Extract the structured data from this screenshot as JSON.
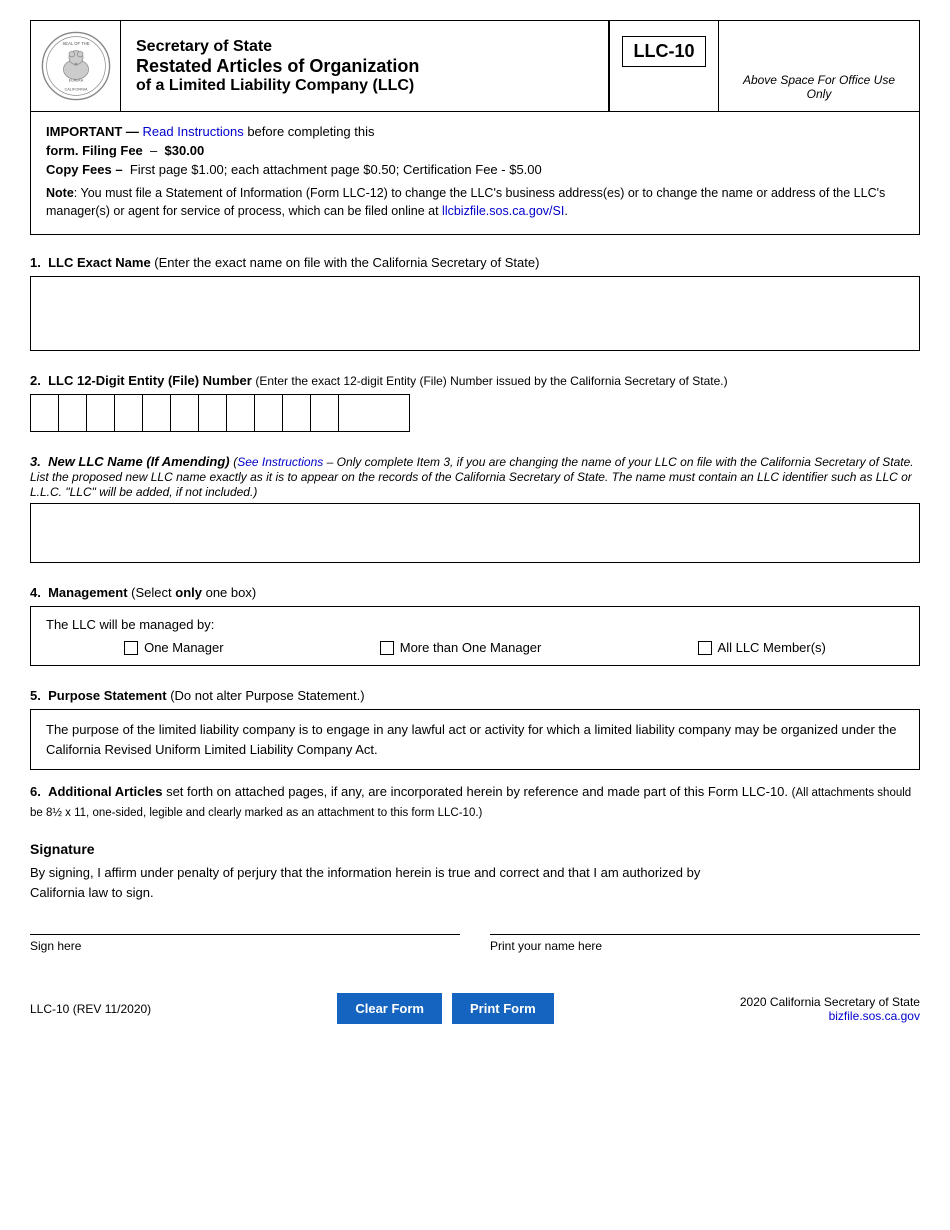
{
  "header": {
    "agency": "Secretary of State",
    "form_title": "Restated Articles of Organization",
    "form_subtitle": "of a Limited Liability Company",
    "form_subtitle_abbr": "(LLC)",
    "form_id": "LLC-10",
    "office_use": "Above Space For Office Use Only"
  },
  "info": {
    "important_prefix": "IMPORTANT — ",
    "important_link_text": "Read Instructions",
    "important_suffix": " before completing this",
    "form_fee_label": "form. Filing Fee",
    "form_fee_dash": "–",
    "form_fee_amount": "$30.00",
    "copy_fees_label": "Copy Fees –",
    "copy_fees_detail": "First page $1.00; each attachment page $0.50; Certification Fee - $5.00",
    "note_label": "Note",
    "note_text": ": You must file a Statement of Information (Form LLC-12) to change the LLC's business address(es) or to change the name or address of the LLC's manager(s) or agent for service of process, which can be filed online at ",
    "note_link": "llcbizfile.sos.ca.gov/SI",
    "note_end": "."
  },
  "section1": {
    "number": "1.",
    "label": "LLC Exact Name",
    "description": "(Enter the exact name on file with the California Secretary of State)"
  },
  "section2": {
    "number": "2.",
    "label": "LLC 12-Digit Entity (File) Number",
    "description": "(Enter the exact 12-digit Entity (File) Number issued by the California Secretary of State.)",
    "cells": 12
  },
  "section3": {
    "number": "3.",
    "label": "New LLC Name (If Amending)",
    "instructions_link": "See Instructions",
    "description": "– Only complete Item 3, if you are changing the name of your LLC on file with the California Secretary of State.  List the proposed new LLC name exactly as it is to appear on the records of the California Secretary of State. The name must contain an LLC identifier such as LLC or L.L.C. \"LLC\" will be added, if not included."
  },
  "section4": {
    "number": "4.",
    "label": "Management",
    "description": "(Select ",
    "bold_word": "only",
    "description2": " one box)",
    "managed_by": "The LLC will be managed by:",
    "option1": "One Manager",
    "option2": "More than One Manager",
    "option3": "All LLC Member(s)"
  },
  "section5": {
    "number": "5.",
    "label": "Purpose Statement",
    "description": "(Do not alter Purpose Statement.)",
    "text": "The purpose of the limited liability company is to engage in any lawful act or activity for which a limited liability company may be organized under the California Revised Uniform Limited Liability Company Act."
  },
  "section6": {
    "number": "6.",
    "label": "Additional Articles",
    "text": "set forth on attached pages, if any, are incorporated herein by reference and made part of this Form LLC-10.",
    "note": "(All attachments should be 8½ x 11, one-sided, legible and clearly marked as an attachment to this form LLC-10.)"
  },
  "signature": {
    "title": "Signature",
    "text1": "By signing, I affirm under penalty of perjury that the information herein is true and correct and that I am authorized by",
    "text2": "California law to sign.",
    "sign_here": "Sign here",
    "print_name": "Print your name here"
  },
  "footer": {
    "form_id": "LLC-10 (REV 11/2020)",
    "clear_btn": "Clear Form",
    "print_btn": "Print Form",
    "copyright": "2020 California Secretary of State",
    "website": "bizfile.sos.ca.gov"
  }
}
